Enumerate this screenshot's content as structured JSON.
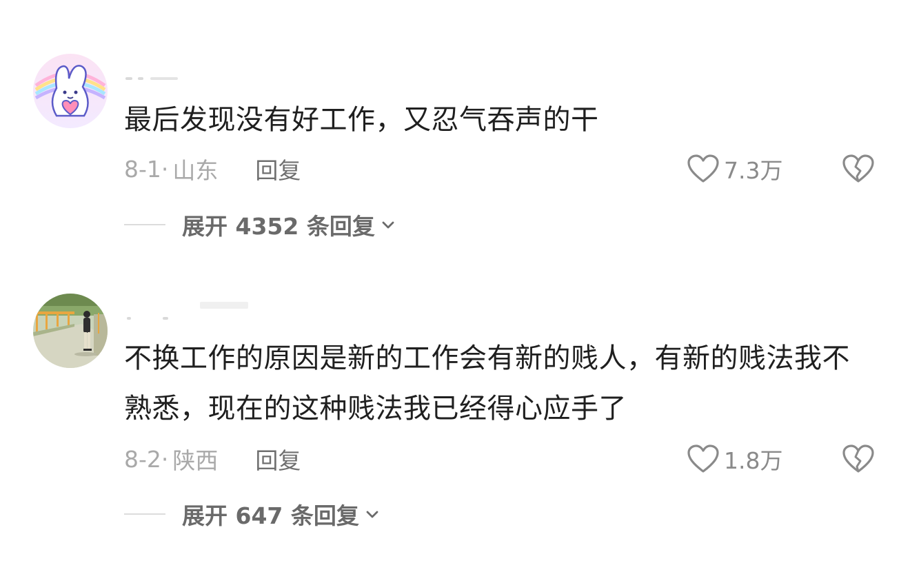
{
  "comments": [
    {
      "username": "",
      "content": "最后发现没有好工作，又忍气吞声的干",
      "date": "8-1",
      "location": "山东",
      "reply_label": "回复",
      "likes": "7.3万",
      "expand_label": "展开 4352 条回复"
    },
    {
      "username": "",
      "content": "不换工作的原因是新的工作会有新的贱人，有新的贱法我不熟悉，现在的这种贱法我已经得心应手了",
      "date": "8-2",
      "location": "陕西",
      "reply_label": "回复",
      "likes": "1.8万",
      "expand_label": "展开 647 条回复"
    }
  ],
  "meta_separator": "·",
  "colors": {
    "text": "#1f1f1f",
    "meta": "#a9a9a9",
    "reply": "#6f6f6f",
    "icon": "#8a8a8a",
    "expand": "#6a6a6a"
  },
  "icons": {
    "like": "heart-outline-icon",
    "dislike": "broken-heart-icon",
    "expand": "chevron-down-icon"
  }
}
